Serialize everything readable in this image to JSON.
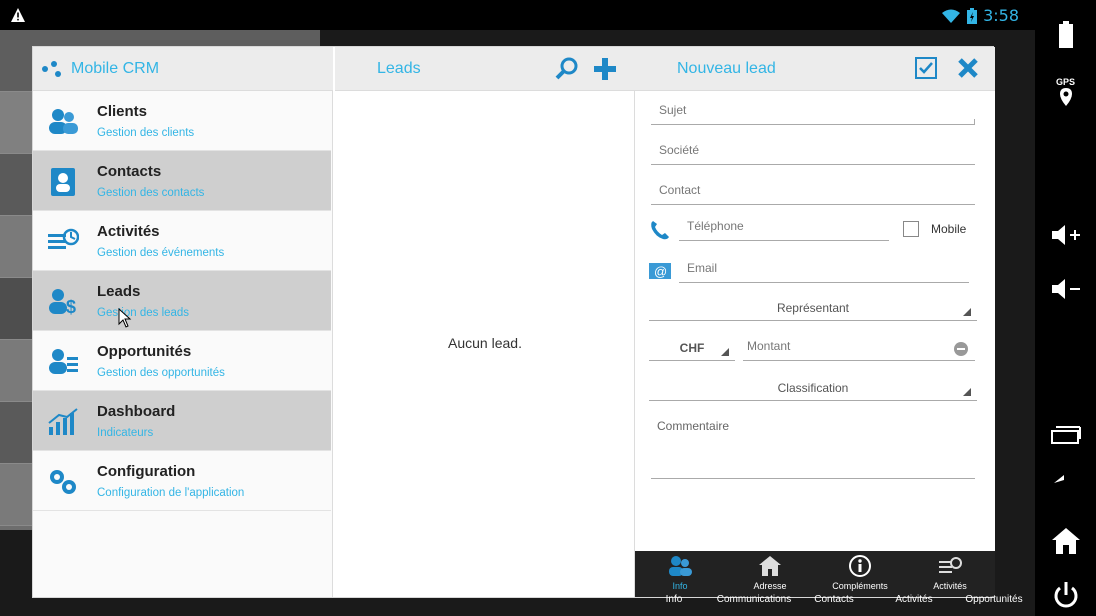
{
  "status": {
    "time": "3:58"
  },
  "sysbar": {
    "gps": "GPS"
  },
  "app": {
    "left_title": "Mobile CRM",
    "mid_title": "Leads",
    "right_title": "Nouveau lead"
  },
  "menu": {
    "items": [
      {
        "title": "Clients",
        "subtitle": "Gestion des clients"
      },
      {
        "title": "Contacts",
        "subtitle": "Gestion des contacts"
      },
      {
        "title": "Activités",
        "subtitle": "Gestion des événements"
      },
      {
        "title": "Leads",
        "subtitle": "Gestion des leads"
      },
      {
        "title": "Opportunités",
        "subtitle": "Gestion des opportunités"
      },
      {
        "title": "Dashboard",
        "subtitle": "Indicateurs"
      },
      {
        "title": "Configuration",
        "subtitle": "Configuration de l'application"
      }
    ]
  },
  "leads": {
    "empty_text": "Aucun lead."
  },
  "form": {
    "subject": "Sujet",
    "company": "Société",
    "contact": "Contact",
    "phone": "Téléphone",
    "mobile_label": "Mobile",
    "email": "Email",
    "representative": "Représentant",
    "currency": "CHF",
    "amount": "Montant",
    "classification": "Classification",
    "comment": "Commentaire"
  },
  "tabs": [
    {
      "label": "Info"
    },
    {
      "label": "Adresse"
    },
    {
      "label": "Compléments"
    },
    {
      "label": "Activités"
    },
    {
      "label": "Opportunités"
    }
  ],
  "ghost_tabs": [
    "Info",
    "Communications",
    "Contacts",
    "Activités",
    "Opportunités"
  ],
  "colors": {
    "accent": "#33b5e5",
    "icon_blue": "#1e88c7"
  }
}
